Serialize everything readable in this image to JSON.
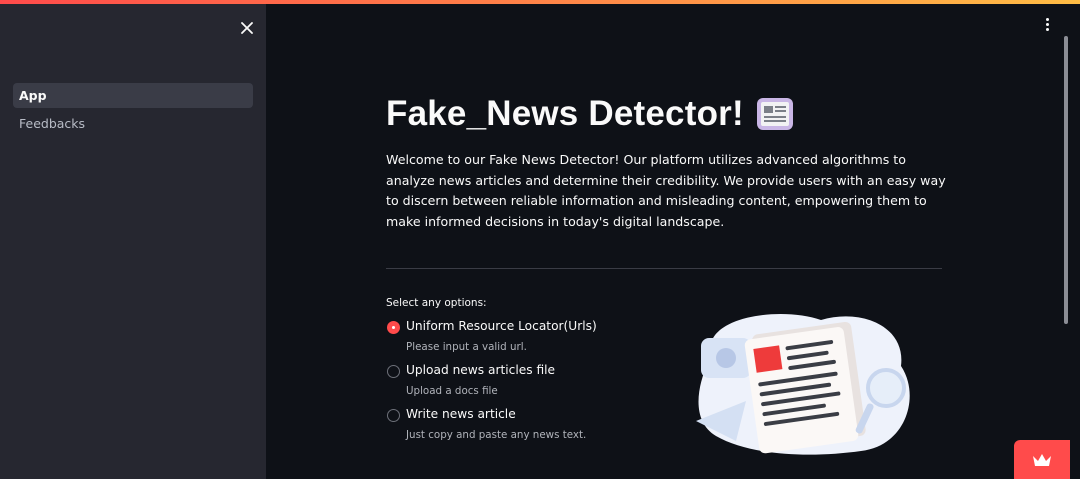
{
  "colors": {
    "accent": "#ff4b4b",
    "sidebar_bg": "#262730",
    "main_bg": "#0e1117"
  },
  "sidebar": {
    "close_icon": "close-icon",
    "items": [
      {
        "label": "App",
        "active": true
      },
      {
        "label": "Feedbacks",
        "active": false
      }
    ]
  },
  "header": {
    "menu_icon": "vertical-ellipsis-icon"
  },
  "main": {
    "title": "Fake_News Detector!",
    "title_icon": "newspaper-icon",
    "description": "Welcome to our Fake News Detector! Our platform utilizes advanced algorithms to analyze news articles and determine their credibility. We provide users with an easy way to discern between reliable information and misleading content, empowering them to make informed decisions in today's digital landscape.",
    "radio": {
      "label": "Select any options:",
      "selected_index": 0,
      "options": [
        {
          "label": "Uniform Resource Locator(Urls)",
          "caption": "Please input a valid url."
        },
        {
          "label": "Upload news articles file",
          "caption": "Upload a docs file"
        },
        {
          "label": "Write news article",
          "caption": "Just copy and paste any news text."
        }
      ]
    },
    "illustration_icon": "news-document-illustration"
  },
  "footer": {
    "badge_icon": "crown-icon"
  }
}
